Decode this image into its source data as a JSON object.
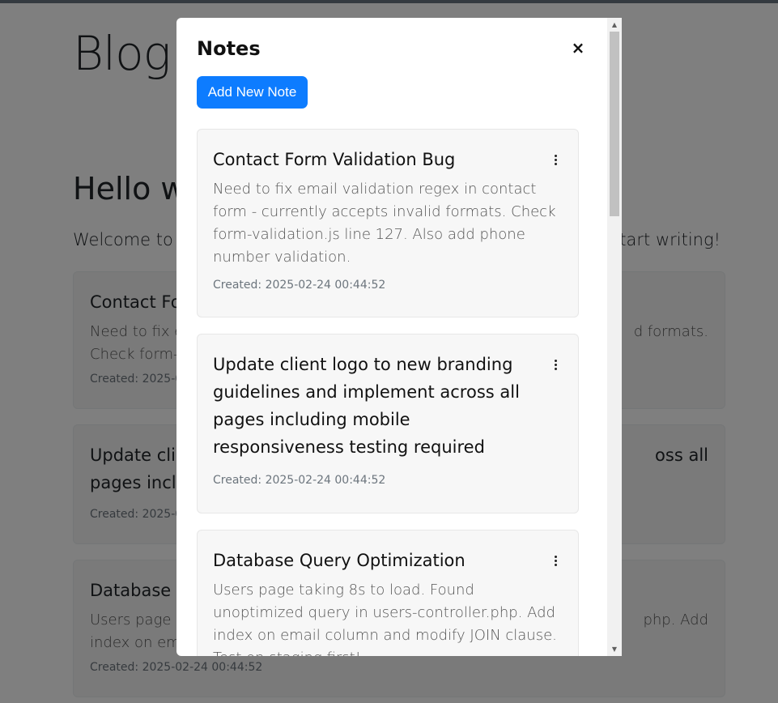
{
  "page": {
    "blog_title": "Blog",
    "hello_heading": "Hello w",
    "welcome_left": "Welcome to V",
    "welcome_right": "start writing!"
  },
  "background_notes": [
    {
      "title": "Contact Fo",
      "text_left": "Need to fix e",
      "text_right": "d formats.",
      "text_line2": "Check form-",
      "date": "Created: 2025-0"
    },
    {
      "title_left": "Update clie",
      "title_right": "oss all",
      "title_line2": "pages inclu",
      "date": "Created: 2025-0"
    },
    {
      "title": "Database C",
      "text_left": "Users page t",
      "text_right": "php. Add",
      "text_line2": "index on em",
      "date": "Created: 2025-02-24 00:44:52"
    }
  ],
  "modal": {
    "title": "Notes",
    "close_symbol": "×",
    "add_button_label": "Add New Note",
    "notes": [
      {
        "title": "Contact Form Validation Bug",
        "text": "Need to fix email validation regex in contact form - currently accepts invalid formats. Check form-validation.js line 127. Also add phone number validation.",
        "date": "Created: 2025-02-24 00:44:52"
      },
      {
        "title": "Update client logo to new branding guidelines and implement across all pages including mobile responsiveness testing required",
        "text": "",
        "date": "Created: 2025-02-24 00:44:52"
      },
      {
        "title": "Database Query Optimization",
        "text": "Users page taking 8s to load. Found unoptimized query in users-controller.php. Add index on email column and modify JOIN clause. Test on staging first!",
        "date": ""
      }
    ]
  },
  "icons": {
    "scroll_up": "▲",
    "scroll_down": "▼"
  },
  "colors": {
    "primary_button": "#0d7cff",
    "overlay": "rgba(0,0,0,0.5)",
    "card_background": "#f7f7f7"
  }
}
